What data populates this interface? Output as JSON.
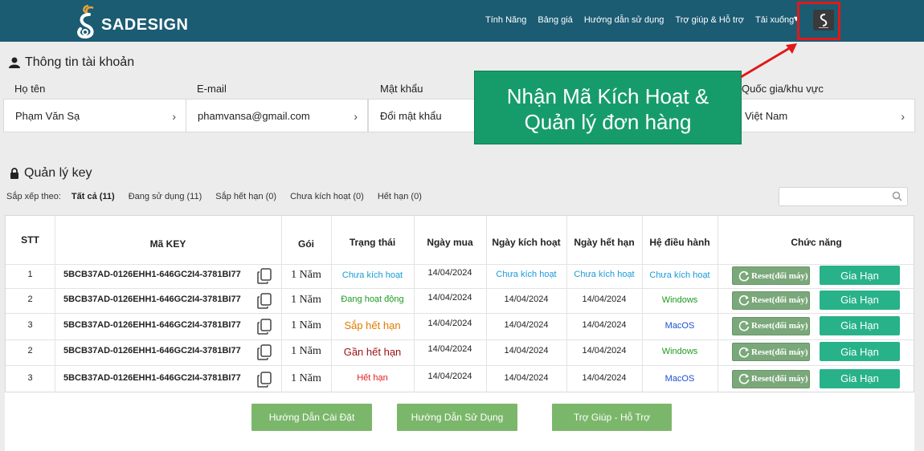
{
  "header": {
    "brand": "SADESIGN",
    "nav": [
      "Tính Năng",
      "Bảng giá",
      "Hướng dẫn sử dụng",
      "Trợ giúp & Hỗ trợ",
      "Tải xuống"
    ],
    "bg_color": "#1b5c73"
  },
  "account": {
    "title": "Thông tin tài khoản",
    "fields": [
      {
        "label": "Họ tên",
        "value": "Phạm Văn Sạ"
      },
      {
        "label": "E-mail",
        "value": "phamvansa@gmail.com"
      },
      {
        "label": "Mật khẩu",
        "value": "Đổi mật khẩu"
      },
      {
        "label": "Quốc gia/khu vực",
        "value": "Việt Nam"
      }
    ]
  },
  "callout": {
    "line1": "Nhận Mã Kích Hoạt &",
    "line2": "Quản lý đơn hàng",
    "color": "#169c6a"
  },
  "keys": {
    "title": "Quản lý key",
    "filter_label": "Sắp xếp theo:",
    "filters": [
      "Tất cả (11)",
      "Đang sử dụng (11)",
      "Sắp hết hạn (0)",
      "Chưa kích hoạt (0)",
      "Hết hạn (0)"
    ],
    "search_placeholder": "",
    "columns": [
      "STT",
      "Mã KEY",
      "Gói",
      "Trạng thái",
      "Ngày mua",
      "Ngày kích hoạt",
      "Ngày hết hạn",
      "Hệ điều hành",
      "Chức năng"
    ],
    "rows": [
      {
        "stt": "1",
        "key": "5BCB37AD-0126EHH1-646GC2I4-3781BI77",
        "pkg": "1 Năm",
        "status": "Chưa kích hoạt",
        "buy": "14/04/2024",
        "activate": "Chưa kích hoạt",
        "expire": "Chưa kích hoạt",
        "os": "Chưa kích hoạt",
        "reset": "Reset(đổi máy)",
        "renew": "Gia Hạn"
      },
      {
        "stt": "2",
        "key": "5BCB37AD-0126EHH1-646GC2I4-3781BI77",
        "pkg": "1 Năm",
        "status": "Đang hoạt động",
        "buy": "14/04/2024",
        "activate": "14/04/2024",
        "expire": "14/04/2024",
        "os": "Windows",
        "reset": "Reset(đổi máy)",
        "renew": "Gia Hạn"
      },
      {
        "stt": "3",
        "key": "5BCB37AD-0126EHH1-646GC2I4-3781BI77",
        "pkg": "1 Năm",
        "status": "Sắp hết hạn",
        "buy": "14/04/2024",
        "activate": "14/04/2024",
        "expire": "14/04/2024",
        "os": "MacOS",
        "reset": "Reset(đổi máy)",
        "renew": "Gia Hạn"
      },
      {
        "stt": "2",
        "key": "5BCB37AD-0126EHH1-646GC2I4-3781BI77",
        "pkg": "1 Năm",
        "status": "Gần hết hạn",
        "buy": "14/04/2024",
        "activate": "14/04/2024",
        "expire": "14/04/2024",
        "os": "Windows",
        "reset": "Reset(đổi máy)",
        "renew": "Gia Hạn"
      },
      {
        "stt": "3",
        "key": "5BCB37AD-0126EHH1-646GC2I4-3781BI77",
        "pkg": "1 Năm",
        "status": "Hết hạn",
        "buy": "14/04/2024",
        "activate": "14/04/2024",
        "expire": "14/04/2024",
        "os": "MacOS",
        "reset": "Reset(đổi máy)",
        "renew": "Gia Hạn"
      }
    ]
  },
  "bottom_buttons": [
    "Hướng Dẫn Cài Đặt",
    "Hướng Dẫn Sử Dụng",
    "Trợ Giúp - Hỗ Trợ"
  ]
}
